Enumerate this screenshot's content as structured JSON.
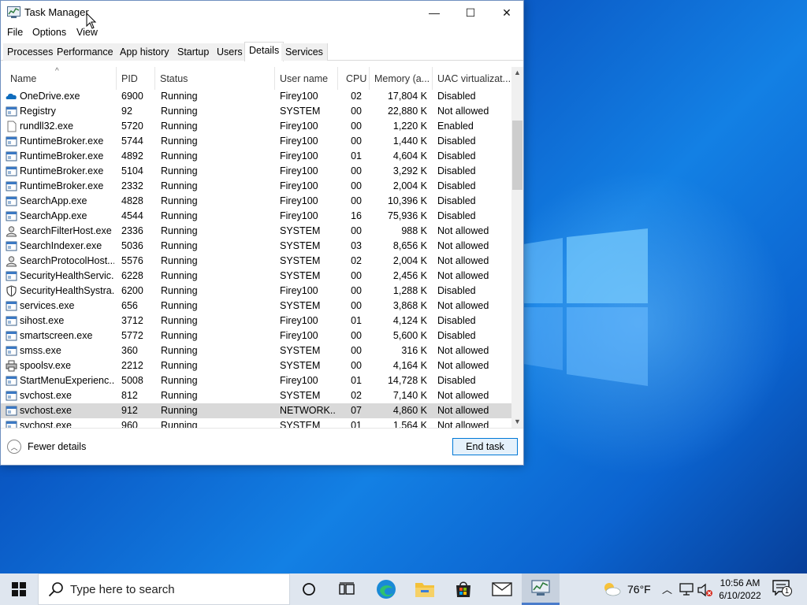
{
  "window": {
    "title": "Task Manager",
    "minimize": "—",
    "maximize": "☐",
    "close": "✕"
  },
  "menu": [
    "File",
    "Options",
    "View"
  ],
  "tabs": [
    "Processes",
    "Performance",
    "App history",
    "Startup",
    "Users",
    "Details",
    "Services"
  ],
  "active_tab": "Details",
  "columns": [
    "Name",
    "PID",
    "Status",
    "User name",
    "CPU",
    "Memory (a...",
    "UAC virtualizat..."
  ],
  "rows": [
    {
      "icon": "onedrive-icon",
      "name": "OneDrive.exe",
      "pid": "6900",
      "status": "Running",
      "user": "Firey100",
      "cpu": "02",
      "mem": "17,804 K",
      "uac": "Disabled"
    },
    {
      "icon": "app-window-icon",
      "name": "Registry",
      "pid": "92",
      "status": "Running",
      "user": "SYSTEM",
      "cpu": "00",
      "mem": "22,880 K",
      "uac": "Not allowed"
    },
    {
      "icon": "blank-file-icon",
      "name": "rundll32.exe",
      "pid": "5720",
      "status": "Running",
      "user": "Firey100",
      "cpu": "00",
      "mem": "1,220 K",
      "uac": "Enabled"
    },
    {
      "icon": "app-window-icon",
      "name": "RuntimeBroker.exe",
      "pid": "5744",
      "status": "Running",
      "user": "Firey100",
      "cpu": "00",
      "mem": "1,440 K",
      "uac": "Disabled"
    },
    {
      "icon": "app-window-icon",
      "name": "RuntimeBroker.exe",
      "pid": "4892",
      "status": "Running",
      "user": "Firey100",
      "cpu": "01",
      "mem": "4,604 K",
      "uac": "Disabled"
    },
    {
      "icon": "app-window-icon",
      "name": "RuntimeBroker.exe",
      "pid": "5104",
      "status": "Running",
      "user": "Firey100",
      "cpu": "00",
      "mem": "3,292 K",
      "uac": "Disabled"
    },
    {
      "icon": "app-window-icon",
      "name": "RuntimeBroker.exe",
      "pid": "2332",
      "status": "Running",
      "user": "Firey100",
      "cpu": "00",
      "mem": "2,004 K",
      "uac": "Disabled"
    },
    {
      "icon": "app-window-icon",
      "name": "SearchApp.exe",
      "pid": "4828",
      "status": "Running",
      "user": "Firey100",
      "cpu": "00",
      "mem": "10,396 K",
      "uac": "Disabled"
    },
    {
      "icon": "app-window-icon",
      "name": "SearchApp.exe",
      "pid": "4544",
      "status": "Running",
      "user": "Firey100",
      "cpu": "16",
      "mem": "75,936 K",
      "uac": "Disabled"
    },
    {
      "icon": "person-icon",
      "name": "SearchFilterHost.exe",
      "pid": "2336",
      "status": "Running",
      "user": "SYSTEM",
      "cpu": "00",
      "mem": "988 K",
      "uac": "Not allowed"
    },
    {
      "icon": "app-window-icon",
      "name": "SearchIndexer.exe",
      "pid": "5036",
      "status": "Running",
      "user": "SYSTEM",
      "cpu": "03",
      "mem": "8,656 K",
      "uac": "Not allowed"
    },
    {
      "icon": "person-icon",
      "name": "SearchProtocolHost....",
      "pid": "5576",
      "status": "Running",
      "user": "SYSTEM",
      "cpu": "02",
      "mem": "2,004 K",
      "uac": "Not allowed"
    },
    {
      "icon": "app-window-icon",
      "name": "SecurityHealthServic...",
      "pid": "6228",
      "status": "Running",
      "user": "SYSTEM",
      "cpu": "00",
      "mem": "2,456 K",
      "uac": "Not allowed"
    },
    {
      "icon": "shield-icon",
      "name": "SecurityHealthSystra...",
      "pid": "6200",
      "status": "Running",
      "user": "Firey100",
      "cpu": "00",
      "mem": "1,288 K",
      "uac": "Disabled"
    },
    {
      "icon": "app-window-icon",
      "name": "services.exe",
      "pid": "656",
      "status": "Running",
      "user": "SYSTEM",
      "cpu": "00",
      "mem": "3,868 K",
      "uac": "Not allowed"
    },
    {
      "icon": "app-window-icon",
      "name": "sihost.exe",
      "pid": "3712",
      "status": "Running",
      "user": "Firey100",
      "cpu": "01",
      "mem": "4,124 K",
      "uac": "Disabled"
    },
    {
      "icon": "app-window-icon",
      "name": "smartscreen.exe",
      "pid": "5772",
      "status": "Running",
      "user": "Firey100",
      "cpu": "00",
      "mem": "5,600 K",
      "uac": "Disabled"
    },
    {
      "icon": "app-window-icon",
      "name": "smss.exe",
      "pid": "360",
      "status": "Running",
      "user": "SYSTEM",
      "cpu": "00",
      "mem": "316 K",
      "uac": "Not allowed"
    },
    {
      "icon": "printer-icon",
      "name": "spoolsv.exe",
      "pid": "2212",
      "status": "Running",
      "user": "SYSTEM",
      "cpu": "00",
      "mem": "4,164 K",
      "uac": "Not allowed"
    },
    {
      "icon": "app-window-icon",
      "name": "StartMenuExperienc...",
      "pid": "5008",
      "status": "Running",
      "user": "Firey100",
      "cpu": "01",
      "mem": "14,728 K",
      "uac": "Disabled"
    },
    {
      "icon": "app-window-icon",
      "name": "svchost.exe",
      "pid": "812",
      "status": "Running",
      "user": "SYSTEM",
      "cpu": "02",
      "mem": "7,140 K",
      "uac": "Not allowed"
    },
    {
      "icon": "app-window-icon",
      "name": "svchost.exe",
      "pid": "912",
      "status": "Running",
      "user": "NETWORK...",
      "cpu": "07",
      "mem": "4,860 K",
      "uac": "Not allowed",
      "selected": true
    },
    {
      "icon": "app-window-icon",
      "name": "svchost.exe",
      "pid": "960",
      "status": "Running",
      "user": "SYSTEM",
      "cpu": "01",
      "mem": "1,564 K",
      "uac": "Not allowed"
    }
  ],
  "footer": {
    "fewer_details": "Fewer details",
    "end_task": "End task"
  },
  "taskbar": {
    "search_placeholder": "Type here to search",
    "weather": "76°F",
    "time": "10:56 AM",
    "date": "6/10/2022",
    "notification_count": "1",
    "pinned": [
      "cortana-icon",
      "task-view-icon",
      "edge-icon",
      "file-explorer-icon",
      "store-icon",
      "mail-icon",
      "task-manager-icon"
    ]
  },
  "colors": {
    "accent": "#0078d7",
    "selected_row": "#d9d9d9",
    "taskbar": "#dfe6ef",
    "desktop": "#0a58c4"
  }
}
